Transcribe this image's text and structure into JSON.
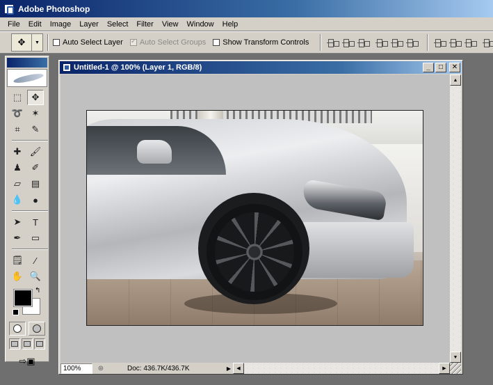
{
  "app": {
    "title": "Adobe Photoshop"
  },
  "menu": [
    "File",
    "Edit",
    "Image",
    "Layer",
    "Select",
    "Filter",
    "View",
    "Window",
    "Help"
  ],
  "options": {
    "auto_select_layer": "Auto Select Layer",
    "auto_select_groups": "Auto Select Groups",
    "show_transform_controls": "Show Transform Controls"
  },
  "document": {
    "title": "Untitled-1 @ 100% (Layer 1, RGB/8)",
    "zoom": "100%",
    "doc_info": "Doc: 436.7K/436.7K"
  },
  "colors": {
    "foreground": "#000000",
    "background": "#ffffff",
    "titlebar": "#0a246a"
  }
}
